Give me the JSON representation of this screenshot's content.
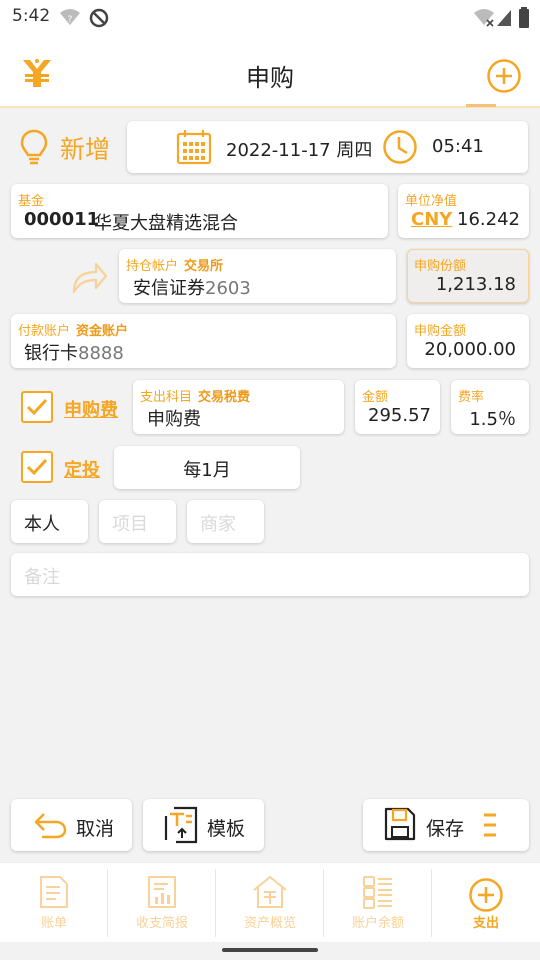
{
  "status": {
    "time": "5:42"
  },
  "header": {
    "title": "申购",
    "logo_icon": "yen-logo-icon",
    "add_icon": "plus-circle-icon"
  },
  "entry": {
    "mode_label": "新增",
    "date": "2022-11-17 周四",
    "time": "05:41"
  },
  "fund": {
    "label": "基金",
    "code": "000011",
    "name": "华夏大盘精选混合"
  },
  "nav": {
    "label": "单位净值",
    "currency": "CNY",
    "value": "16.242"
  },
  "holding": {
    "label": "持仓帐户",
    "sub_label": "交易所",
    "name": "安信证券",
    "number": "2603"
  },
  "shares": {
    "label": "申购份额",
    "value": "1,213.18"
  },
  "payment": {
    "label": "付款账户",
    "sub_label": "资金账户",
    "name": "银行卡",
    "number": "8888"
  },
  "amount": {
    "label": "申购金额",
    "value": "20,000.00"
  },
  "fee": {
    "check_label": "申购费",
    "subject_label": "支出科目",
    "subject_sub_label": "交易税费",
    "subject_value": "申购费",
    "amount_label": "金额",
    "amount_value": "295.57",
    "rate_label": "费率",
    "rate_value": "1.5％"
  },
  "schedule": {
    "check_label": "定投",
    "value": "每1月"
  },
  "tags": {
    "person": "本人",
    "project_placeholder": "项目",
    "merchant_placeholder": "商家"
  },
  "note": {
    "placeholder": "备注"
  },
  "actions": {
    "cancel": "取消",
    "template": "模板",
    "save": "保存"
  },
  "nav_tabs": [
    {
      "label": "账单"
    },
    {
      "label": "收支简报"
    },
    {
      "label": "资产概览"
    },
    {
      "label": "账户余额"
    },
    {
      "label": "支出"
    }
  ],
  "colors": {
    "accent": "#f5a623",
    "accent_light": "#f8d29a"
  }
}
